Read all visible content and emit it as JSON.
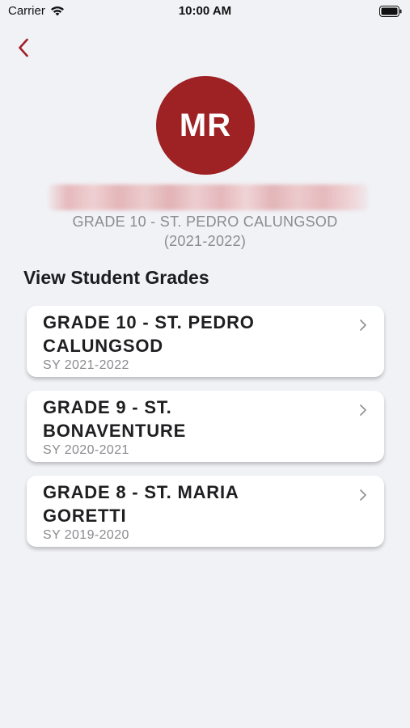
{
  "status_bar": {
    "carrier": "Carrier",
    "time": "10:00 AM"
  },
  "profile": {
    "initials": "MR",
    "class_line1": "GRADE 10 - ST. PEDRO CALUNGSOD",
    "class_line2": "(2021-2022)"
  },
  "section": {
    "title": "View Student Grades"
  },
  "grades": [
    {
      "line1": "GRADE 10 - ST. PEDRO",
      "line2": "CALUNGSOD",
      "sy": "SY 2021-2022"
    },
    {
      "line1": "GRADE 9 - ST.",
      "line2": "BONAVENTURE",
      "sy": "SY 2020-2021"
    },
    {
      "line1": "GRADE 8 - ST. MARIA",
      "line2": "GORETTI",
      "sy": "SY 2019-2020"
    }
  ],
  "colors": {
    "accent": "#9e2124",
    "background": "#f1f2f6",
    "muted_text": "#8b8b90"
  },
  "icons": {
    "back": "chevron-left-icon",
    "row": "chevron-right-icon",
    "wifi": "wifi-icon",
    "battery": "battery-icon"
  }
}
